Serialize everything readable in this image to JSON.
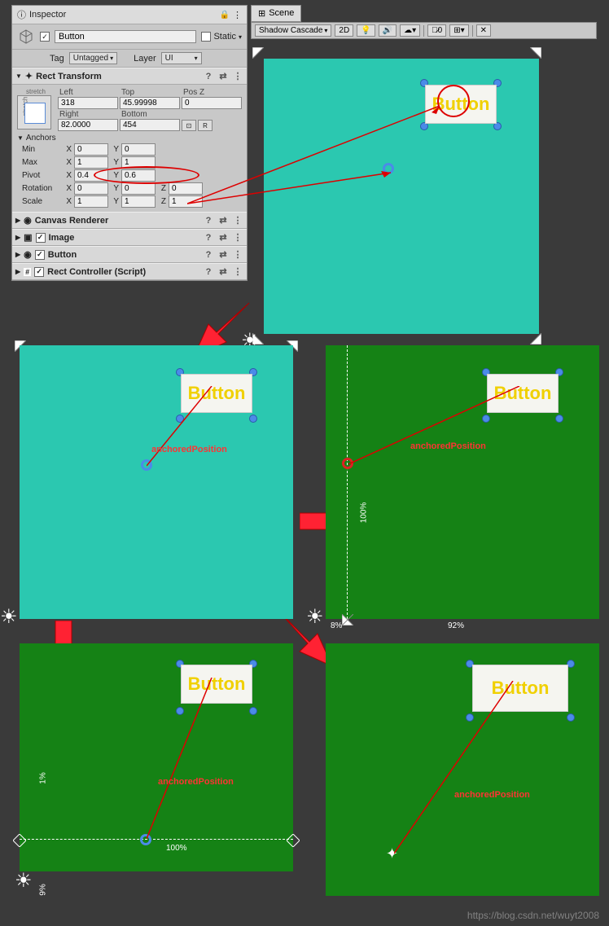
{
  "inspector": {
    "title": "Inspector",
    "object_name": "Button",
    "static_label": "Static",
    "tag_label": "Tag",
    "tag_value": "Untagged",
    "layer_label": "Layer",
    "layer_value": "UI"
  },
  "rect_transform": {
    "title": "Rect Transform",
    "stretch_label": "stretch",
    "left_label": "Left",
    "left": "318",
    "top_label": "Top",
    "top": "45.99998",
    "posz_label": "Pos Z",
    "posz": "0",
    "right_label": "Right",
    "right": "82.0000",
    "bottom_label": "Bottom",
    "bottom": "454",
    "btn_dotted": "⊡",
    "btn_r": "R",
    "anchors_label": "Anchors",
    "min_label": "Min",
    "min_x": "0",
    "min_y": "0",
    "max_label": "Max",
    "max_x": "1",
    "max_y": "1",
    "pivot_label": "Pivot",
    "pivot_x": "0.4",
    "pivot_y": "0.6",
    "rotation_label": "Rotation",
    "rot_x": "0",
    "rot_y": "0",
    "rot_z": "0",
    "scale_label": "Scale",
    "scale_x": "1",
    "scale_y": "1",
    "scale_z": "1",
    "x_label": "X",
    "y_label": "Y",
    "z_label": "Z"
  },
  "components": {
    "canvas_renderer": "Canvas Renderer",
    "image": "Image",
    "button": "Button",
    "rect_controller": "Rect Controller (Script)"
  },
  "scene": {
    "tab": "Scene",
    "shadow": "Shadow Cascade",
    "btn_2d": "2D",
    "vis_count": "0"
  },
  "button_text": "Button",
  "annotations": {
    "anchored_position": "anchoredPosition",
    "pct_100": "100%",
    "pct_92": "92%",
    "pct_8": "8%",
    "pct_1": "1%",
    "pct_9": "9%"
  },
  "watermark": "https://blog.csdn.net/wuyt2008"
}
